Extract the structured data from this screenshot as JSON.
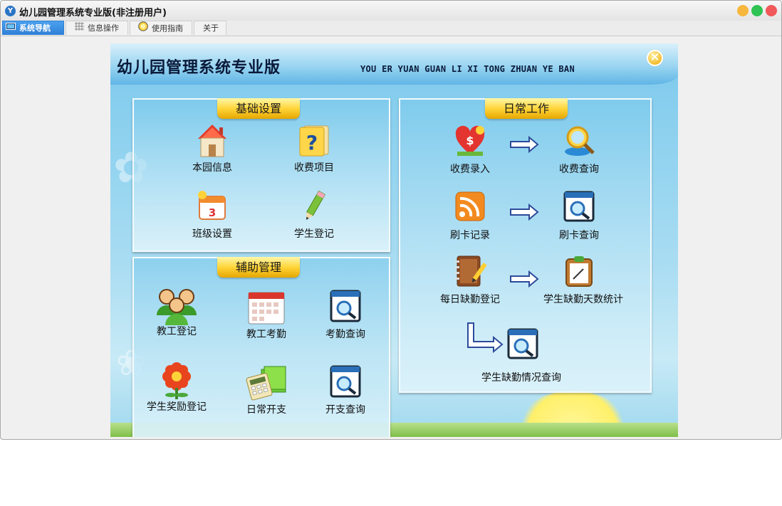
{
  "window": {
    "title": "幼儿园管理系统专业版(非注册用户)"
  },
  "tabs": [
    {
      "label": "系统导航"
    },
    {
      "label": "信息操作"
    },
    {
      "label": "使用指南"
    },
    {
      "label": "关于"
    }
  ],
  "header": {
    "title": "幼儿园管理系统专业版",
    "pinyin": "YOU ER YUAN GUAN LI XI TONG ZHUAN YE BAN"
  },
  "sections": {
    "basic": {
      "title": "基础设置",
      "items": [
        "本园信息",
        "收费项目",
        "班级设置",
        "学生登记"
      ]
    },
    "daily": {
      "title": "日常工作",
      "items": [
        "收费录入",
        "收费查询",
        "刷卡记录",
        "刷卡查询",
        "每日缺勤登记",
        "学生缺勤天数统计",
        "学生缺勤情况查询"
      ]
    },
    "aux": {
      "title": "辅助管理",
      "items": [
        "教工登记",
        "教工考勤",
        "考勤查询",
        "学生奖励登记",
        "日常开支",
        "开支查询"
      ]
    }
  },
  "colors": {
    "accent": "#2f7fd6",
    "banner": "#ffd53a",
    "sky": "#8fd2ef"
  }
}
